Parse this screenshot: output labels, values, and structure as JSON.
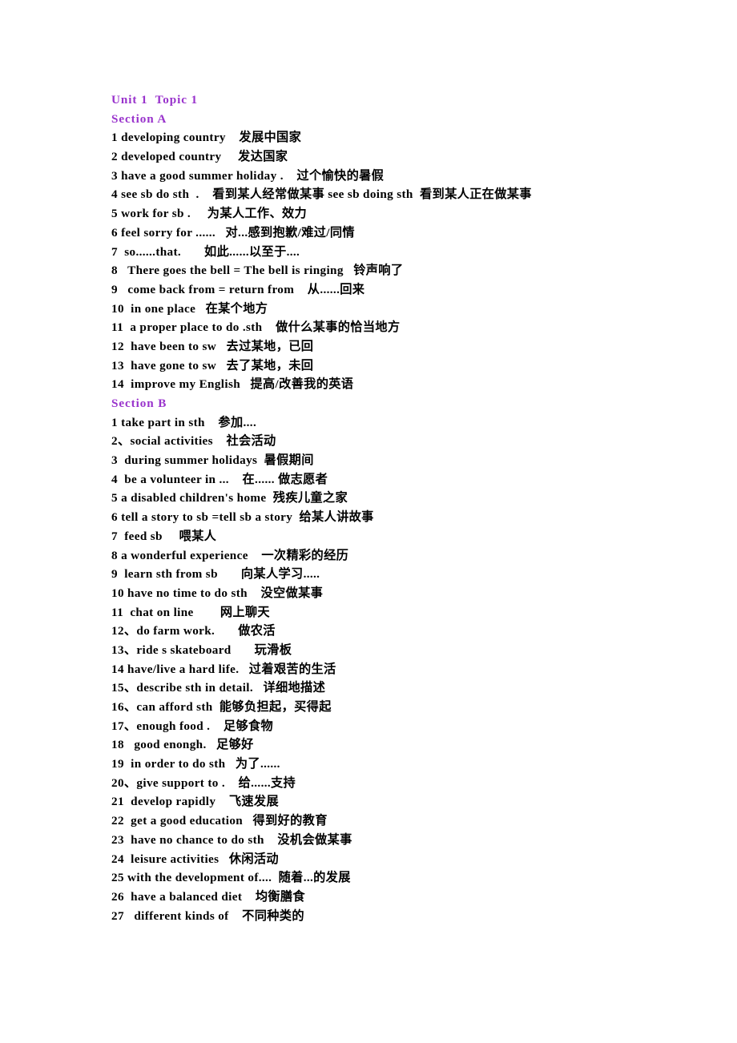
{
  "document": {
    "title": "Unit 1  Topic 1",
    "accent_color": "#9933CC",
    "text_color": "#000000",
    "background_color": "#ffffff",
    "lines": [
      {
        "id": "title",
        "type": "title",
        "text": "Unit 1  Topic 1"
      },
      {
        "id": "section-a",
        "type": "heading",
        "text": "Section A"
      },
      {
        "id": "a-1",
        "type": "entry",
        "text": "1 developing country    发展中国家"
      },
      {
        "id": "a-2",
        "type": "entry",
        "text": "2 developed country     发达国家"
      },
      {
        "id": "a-3",
        "type": "entry",
        "text": "3 have a good summer holiday .    过个愉快的暑假"
      },
      {
        "id": "a-4",
        "type": "entry",
        "text": "4 see sb do sth  .    看到某人经常做某事 see sb doing sth  看到某人正在做某事"
      },
      {
        "id": "a-5",
        "type": "entry",
        "text": "5 work for sb .     为某人工作、效力"
      },
      {
        "id": "a-6",
        "type": "entry",
        "text": "6 feel sorry for ......   对...感到抱歉/难过/同情"
      },
      {
        "id": "a-7",
        "type": "entry",
        "text": "7  so......that.       如此......以至于...."
      },
      {
        "id": "a-8",
        "type": "entry",
        "text": "8   There goes the bell = The bell is ringing   铃声响了"
      },
      {
        "id": "a-9",
        "type": "entry",
        "text": "9   come back from = return from    从......回来"
      },
      {
        "id": "a-10",
        "type": "entry",
        "text": "10  in one place   在某个地方"
      },
      {
        "id": "a-11",
        "type": "entry",
        "text": "11  a proper place to do .sth    做什么某事的恰当地方"
      },
      {
        "id": "a-12",
        "type": "entry",
        "text": "12  have been to sw   去过某地，已回"
      },
      {
        "id": "a-13",
        "type": "entry",
        "text": "13  have gone to sw   去了某地，未回"
      },
      {
        "id": "a-14",
        "type": "entry",
        "text": "14  improve my English   提高/改善我的英语"
      },
      {
        "id": "section-b",
        "type": "heading",
        "text": "Section B"
      },
      {
        "id": "b-1",
        "type": "entry",
        "text": "1 take part in sth    参加...."
      },
      {
        "id": "b-2",
        "type": "entry",
        "text": "2、social activities    社会活动"
      },
      {
        "id": "b-3",
        "type": "entry",
        "text": "3  during summer holidays  暑假期间"
      },
      {
        "id": "b-4",
        "type": "entry",
        "text": "4  be a volunteer in ...    在...... 做志愿者"
      },
      {
        "id": "b-5",
        "type": "entry",
        "text": "5 a disabled children's home  残疾儿童之家"
      },
      {
        "id": "b-6",
        "type": "entry",
        "text": "6 tell a story to sb =tell sb a story  给某人讲故事"
      },
      {
        "id": "b-7",
        "type": "entry",
        "text": "7  feed sb     喂某人"
      },
      {
        "id": "b-8",
        "type": "entry",
        "text": "8 a wonderful experience    一次精彩的经历"
      },
      {
        "id": "b-9",
        "type": "entry",
        "text": "9  learn sth from sb       向某人学习....."
      },
      {
        "id": "b-10",
        "type": "entry",
        "text": "10 have no time to do sth    没空做某事"
      },
      {
        "id": "b-11",
        "type": "entry",
        "text": "11  chat on line        网上聊天"
      },
      {
        "id": "b-12",
        "type": "entry",
        "text": "12、do farm work.       做农活"
      },
      {
        "id": "b-13",
        "type": "entry",
        "text": "13、ride s skateboard       玩滑板"
      },
      {
        "id": "b-14",
        "type": "entry",
        "text": "14 have/live a hard life.   过着艰苦的生活"
      },
      {
        "id": "b-15",
        "type": "entry",
        "text": "15、describe sth in detail.   详细地描述"
      },
      {
        "id": "b-16",
        "type": "entry",
        "text": "16、can afford sth  能够负担起，买得起"
      },
      {
        "id": "b-17",
        "type": "entry",
        "text": "17、enough food .    足够食物"
      },
      {
        "id": "b-18",
        "type": "entry",
        "text": "18   good enongh.   足够好"
      },
      {
        "id": "b-19",
        "type": "entry",
        "text": "19  in order to do sth   为了......"
      },
      {
        "id": "b-20",
        "type": "entry",
        "text": "20、give support to .    给......支持"
      },
      {
        "id": "b-21",
        "type": "entry",
        "text": "21  develop rapidly    飞速发展"
      },
      {
        "id": "b-22",
        "type": "entry",
        "text": "22  get a good education   得到好的教育"
      },
      {
        "id": "b-23",
        "type": "entry",
        "text": "23  have no chance to do sth    没机会做某事"
      },
      {
        "id": "b-24",
        "type": "entry",
        "text": "24  leisure activities   休闲活动"
      },
      {
        "id": "b-25",
        "type": "entry",
        "text": "25 with the development of....  随着...的发展"
      },
      {
        "id": "b-26",
        "type": "entry",
        "text": "26  have a balanced diet    均衡膳食"
      },
      {
        "id": "b-27",
        "type": "entry",
        "text": "27   different kinds of    不同种类的"
      }
    ]
  }
}
